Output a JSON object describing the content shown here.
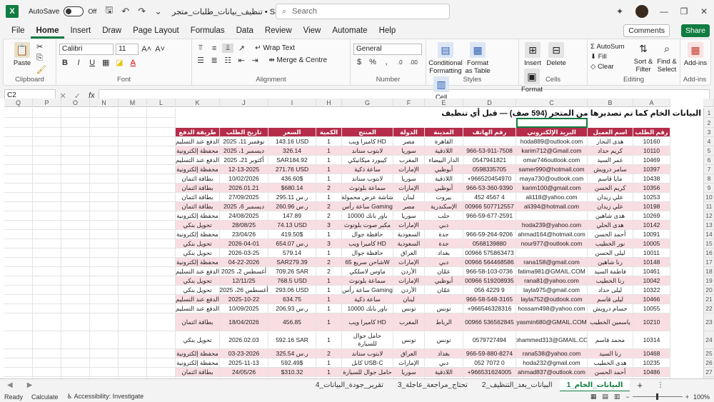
{
  "titlebar": {
    "logo": "X",
    "autosave": "AutoSave",
    "autosave_state": "Off",
    "doc_title": "تنظيف_بيانات_طلبات_متجر • Saved to this PC",
    "search_placeholder": "Search"
  },
  "menu": [
    "File",
    "Home",
    "Insert",
    "Draw",
    "Page Layout",
    "Formulas",
    "Data",
    "Review",
    "View",
    "Automate",
    "Help"
  ],
  "comments": "Comments",
  "share": "Share",
  "ribbon": {
    "paste": "Paste",
    "clipboard": "Clipboard",
    "font_name": "Calibri",
    "font_size": "11",
    "font": "Font",
    "wrap": "Wrap Text",
    "merge": "Merge & Centre",
    "alignment": "Alignment",
    "numfmt": "General",
    "number": "Number",
    "cond": "Conditional Formatting",
    "fmt_table": "Format as Table",
    "cell_styles": "Cell Styles",
    "styles": "Styles",
    "insert": "Insert",
    "delete": "Delete",
    "format": "Format",
    "cells": "Cells",
    "autosum": "AutoSum",
    "fill": "Fill",
    "clear": "Clear",
    "sort": "Sort & Filter",
    "find": "Find & Select",
    "editing": "Editing",
    "addins": "Add-ins",
    "addins_group": "Add-ins"
  },
  "namebox": "C2",
  "columns": [
    "R",
    "Q",
    "P",
    "O",
    "N",
    "M",
    "L",
    "K",
    "J",
    "I",
    "H",
    "G",
    "F",
    "E",
    "D",
    "C",
    "B",
    "A"
  ],
  "sheet_title": "البيانات الخام كما تم تصديرها من المتجر (594 صف) — قبل أي تنظيف",
  "headers": [
    "طريقة الدفع",
    "تاريخ الطلب",
    "السعر",
    "الكمية",
    "المنتج",
    "الدولة",
    "المدينة",
    "رقم الهاتف",
    "البريد الإلكتروني",
    "اسم العميل",
    "رقم الطلب"
  ],
  "rows": [
    [
      "الدفع عند التسليم",
      "نوفمبر 11، 2025",
      "143.16 USD",
      "1",
      "كاميرا ويب HD",
      "مصر",
      "القاهرة",
      "",
      "hoda889@outlook.com",
      "هدى النجار",
      "10160"
    ],
    [
      "محفظة إلكترونية",
      "ديسمبر 1، 2025",
      "326.14",
      "1",
      "لابتوب ستاند",
      "سوريا",
      "اللاذقية",
      "966-53-911-7508",
      "karim712@Gmail.com",
      "كريم حداد",
      "10110"
    ],
    [
      "الدفع عند التسليم",
      "أكتوبر 21، 2025",
      "SAR184.92",
      "1",
      "كيبورد ميكانيكي",
      "المغرب",
      "الدار البيضاء",
      "0547941821",
      "omar746outlook.com",
      "عمر السيد",
      "10469"
    ],
    [
      "محفظة إلكترونية",
      "12-13-2025",
      "271.76 USD",
      "1",
      "ساعة ذكية",
      "الإمارات",
      "أبوظبي",
      "0598335705",
      "samer990@hotmail.com",
      "سامر درويش",
      "10397"
    ],
    [
      "بطاقة ائتمان",
      "10/02/2026",
      "436.60$",
      "1",
      "لابتوب ستاند",
      "سوريا",
      "اللاذقية",
      "+966520454970",
      "maya730@outlook.com",
      "مايا قاسم",
      "10438"
    ],
    [
      "بطاقة ائتمان",
      "2026.01.21",
      "$680.14",
      "2",
      "سماعة بلوتوث",
      "الإمارات",
      "أبوظبي",
      "966-53-360-9390",
      "karim100@gmail.com",
      "كريم الحسن",
      "10356"
    ],
    [
      "بطاقة ائتمان",
      "27/09/2025",
      "295.11 ر.س",
      "1",
      "شاشة عرض محمولة",
      "لبنان",
      "بيروت",
      "452 4567 4",
      "ali118@yahoo.com",
      "علي زيدان",
      "10253"
    ],
    [
      "بطاقة ائتمان",
      "ديسمبر 6، 2025",
      "260.96 ر.س",
      "2",
      "ساعة رأس Gaming",
      "مصر",
      "الإسكندرية",
      "00966 507712557",
      "ali394@hotmail.com",
      "علي زيدان",
      "10198"
    ],
    [
      "محفظة إلكترونية",
      "24/08/2025",
      "147.89",
      "2",
      "باور بانك 10000",
      "سوريا",
      "حلب",
      "966-59-677-2591",
      "",
      "هدى شاهين",
      "10269"
    ],
    [
      "تحويل بنكي",
      "28/08/25",
      "74.13 USD",
      "3",
      "مكبر صوت بلوتوث",
      "الإمارات",
      "دبي",
      "",
      "hoda239@yahoo.com",
      "هدى الحلي",
      "10142"
    ],
    [
      "محفظة إلكترونية",
      "23/04/26",
      "419.50$",
      "1",
      "حافظة جوال",
      "السعودية",
      "جدة",
      "966-59-264-9206",
      "ahmad164@hotmail.com",
      "أحمد الحسن",
      "10091"
    ],
    [
      "تحويل بنكي",
      "2026-04-01",
      "654.07 ر.س",
      "3",
      "كاميرا ويب HD",
      "السعودية",
      "جدة",
      "0568139880",
      "nour977@outlook.com",
      "نور الخطيب",
      "10005"
    ],
    [
      "تحويل بنكي",
      "2026-03-25",
      "579.14",
      "1",
      "حافظة جوال",
      "العراق",
      "بغداد",
      "00966 575863473",
      "",
      "ليلى الحسن",
      "10011"
    ],
    [
      "محفظة إلكترونية",
      "04-22-2026",
      "SAR279.39",
      "2",
      "شاحن سريع 65W",
      "الإمارات",
      "دبي",
      "00966 564468586",
      "rana158@gmail.com",
      "رنا شاهين",
      "10148"
    ],
    [
      "الدفع عند التسليم",
      "أغسطس 2، 2025",
      "709.26 SAR",
      "2",
      "ماوس لاسلكي",
      "الأردن",
      "عمّان",
      "966-58-103-0736",
      "fatima981@GMAIL.COM",
      "فاطمة السيد",
      "10461"
    ],
    [
      "تحويل بنكي",
      "12/11/25",
      "768.5 USD",
      "1",
      "سماعة بلوتوث",
      "الإمارات",
      "أبوظبي",
      "00966 519208935",
      "rana81@yahoo.com",
      "رنا الخطيب",
      "10042"
    ],
    [
      "تحويل بنكي",
      "أغسطس 26، 2025",
      "293.06 USD",
      "1",
      "ساعة رأس Gaming",
      "الأردن",
      "عمّان",
      "056 4229 9",
      "layla975@gmail.com",
      "ليلى حداد",
      "10322"
    ],
    [
      "الدفع عند التسليم",
      "2025-10-22",
      "634.75",
      "1",
      "ساعة ذكية",
      "لبنان",
      "",
      "966-58-548-3165",
      "layla752@outlook.com",
      "ليلى قاسم",
      "10466"
    ],
    [
      "الدفع عند التسليم",
      "10/09/2025",
      "206.93 ر.س",
      "1",
      "باور بانك 10000",
      "تونس",
      "تونس",
      "+966546328316",
      "hossam498@yahoo.com",
      "حسام درويش",
      "10055"
    ],
    [
      "بطاقة ائتمان",
      "18/04/2026",
      "456.85",
      "1",
      "كاميرا ويب HD",
      "المغرب",
      "الرباط",
      "00966 536562845",
      "yasmin680@GMAIL.COM",
      "ياسمين الخطيب",
      "10210"
    ],
    [
      "تحويل بنكي",
      "2026.02.03",
      "592.16 SAR",
      "1",
      "حامل جوال للسيارة",
      "تونس",
      "تونس",
      "0579727494",
      "mohammed313@GMAIL.COM",
      "محمد قاسم",
      "10314"
    ],
    [
      "محفظة إلكترونية",
      "03-23-2026",
      "325.54 ر.س",
      "2",
      "لابتوب ستاند",
      "العراق",
      "بغداد",
      "966-59-880-8274",
      "rana538@yahoo.com",
      "رنا السيد",
      "10468"
    ],
    [
      "محفظة إلكترونية",
      "2025-11-13",
      "592.49$",
      "1",
      "كابل USB-C",
      "الإمارات",
      "دبي",
      "052 7072 0",
      "hoda232@gmail.com",
      "هدى الخطيب",
      "10235"
    ],
    [
      "بطاقة ائتمان",
      "24/05/26",
      "$310.32",
      "1",
      "حامل جوال للسيارة",
      "سوريا",
      "اللاذقية",
      "+966531624005",
      "ahmad837@outlook.com",
      "أحمد الحسن",
      "10486"
    ],
    [
      "الدفع عند التسليم",
      "فبراير 7، 2026",
      "233.31$",
      "1",
      "كاميرا ويب HD",
      "السعودية",
      "جدة",
      "0543105260",
      "omar75@hotmail.com",
      "عمر الحلي",
      "10482"
    ]
  ],
  "tabs": [
    "البيانات_الخام_1",
    "البيانات_بعد_التنظيف_2",
    "تحتاج_مراجعة_عاجلة_3",
    "تقرير_جودة_البيانات_4"
  ],
  "status": {
    "ready": "Ready",
    "calculate": "Calculate",
    "accessibility": "Accessibility: Investigate",
    "zoom": "100%"
  }
}
